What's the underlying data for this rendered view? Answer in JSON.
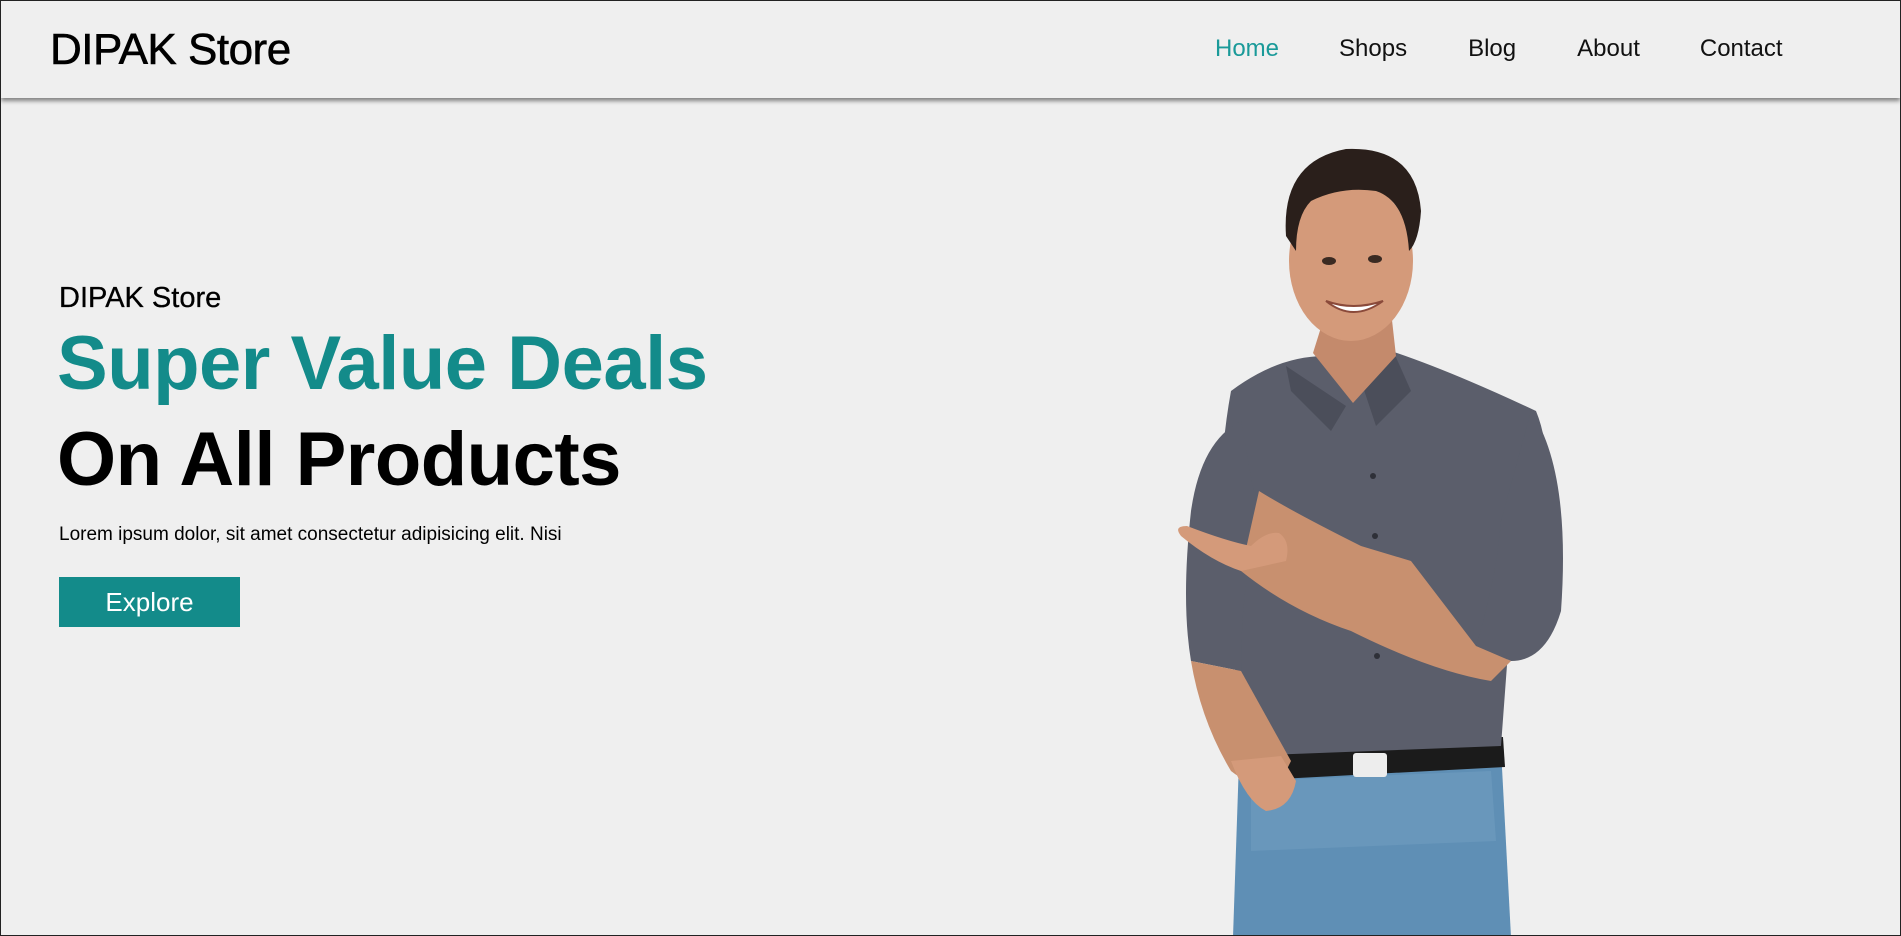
{
  "header": {
    "logo": "DIPAK Store",
    "nav": [
      {
        "label": "Home",
        "active": true
      },
      {
        "label": "Shops",
        "active": false
      },
      {
        "label": "Blog",
        "active": false
      },
      {
        "label": "About",
        "active": false
      },
      {
        "label": "Contact",
        "active": false
      }
    ]
  },
  "hero": {
    "subtitle": "DIPAK Store",
    "headline_1": "Super Value Deals",
    "headline_2": "On All Products",
    "text": "Lorem ipsum dolor, sit amet consectetur adipisicing elit. Nisi",
    "cta_label": "Explore",
    "image": "smiling-man-pointing-photo"
  },
  "colors": {
    "accent": "#138b8a",
    "nav_active": "#1a9a99",
    "background": "#efefef",
    "text": "#000000"
  }
}
